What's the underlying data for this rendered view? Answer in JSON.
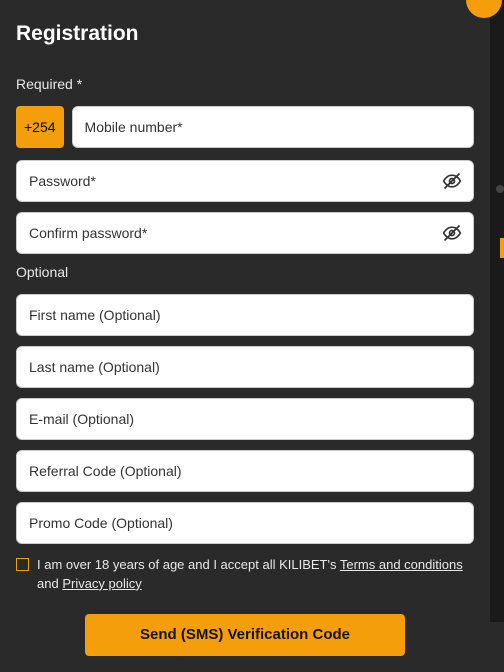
{
  "title": "Registration",
  "labels": {
    "required": "Required *",
    "optional": "Optional"
  },
  "phone": {
    "prefix": "+254",
    "placeholder": "Mobile number*"
  },
  "password": {
    "placeholder": "Password*"
  },
  "confirm": {
    "placeholder": "Confirm password*"
  },
  "optional_fields": {
    "first_name": {
      "placeholder": "First name (Optional)"
    },
    "last_name": {
      "placeholder": "Last name (Optional)"
    },
    "email": {
      "placeholder": "E-mail (Optional)"
    },
    "referral": {
      "placeholder": "Referral Code (Optional)"
    },
    "promo": {
      "placeholder": "Promo Code (Optional)"
    }
  },
  "consent": {
    "pre": "I am over 18 years of age and I accept all KILIBET's ",
    "terms": "Terms and conditions",
    "mid": " and ",
    "privacy": "Privacy policy"
  },
  "submit_label": "Send (SMS) Verification Code",
  "icons": {
    "close": "close-icon",
    "eye_off": "eye-off-icon"
  }
}
